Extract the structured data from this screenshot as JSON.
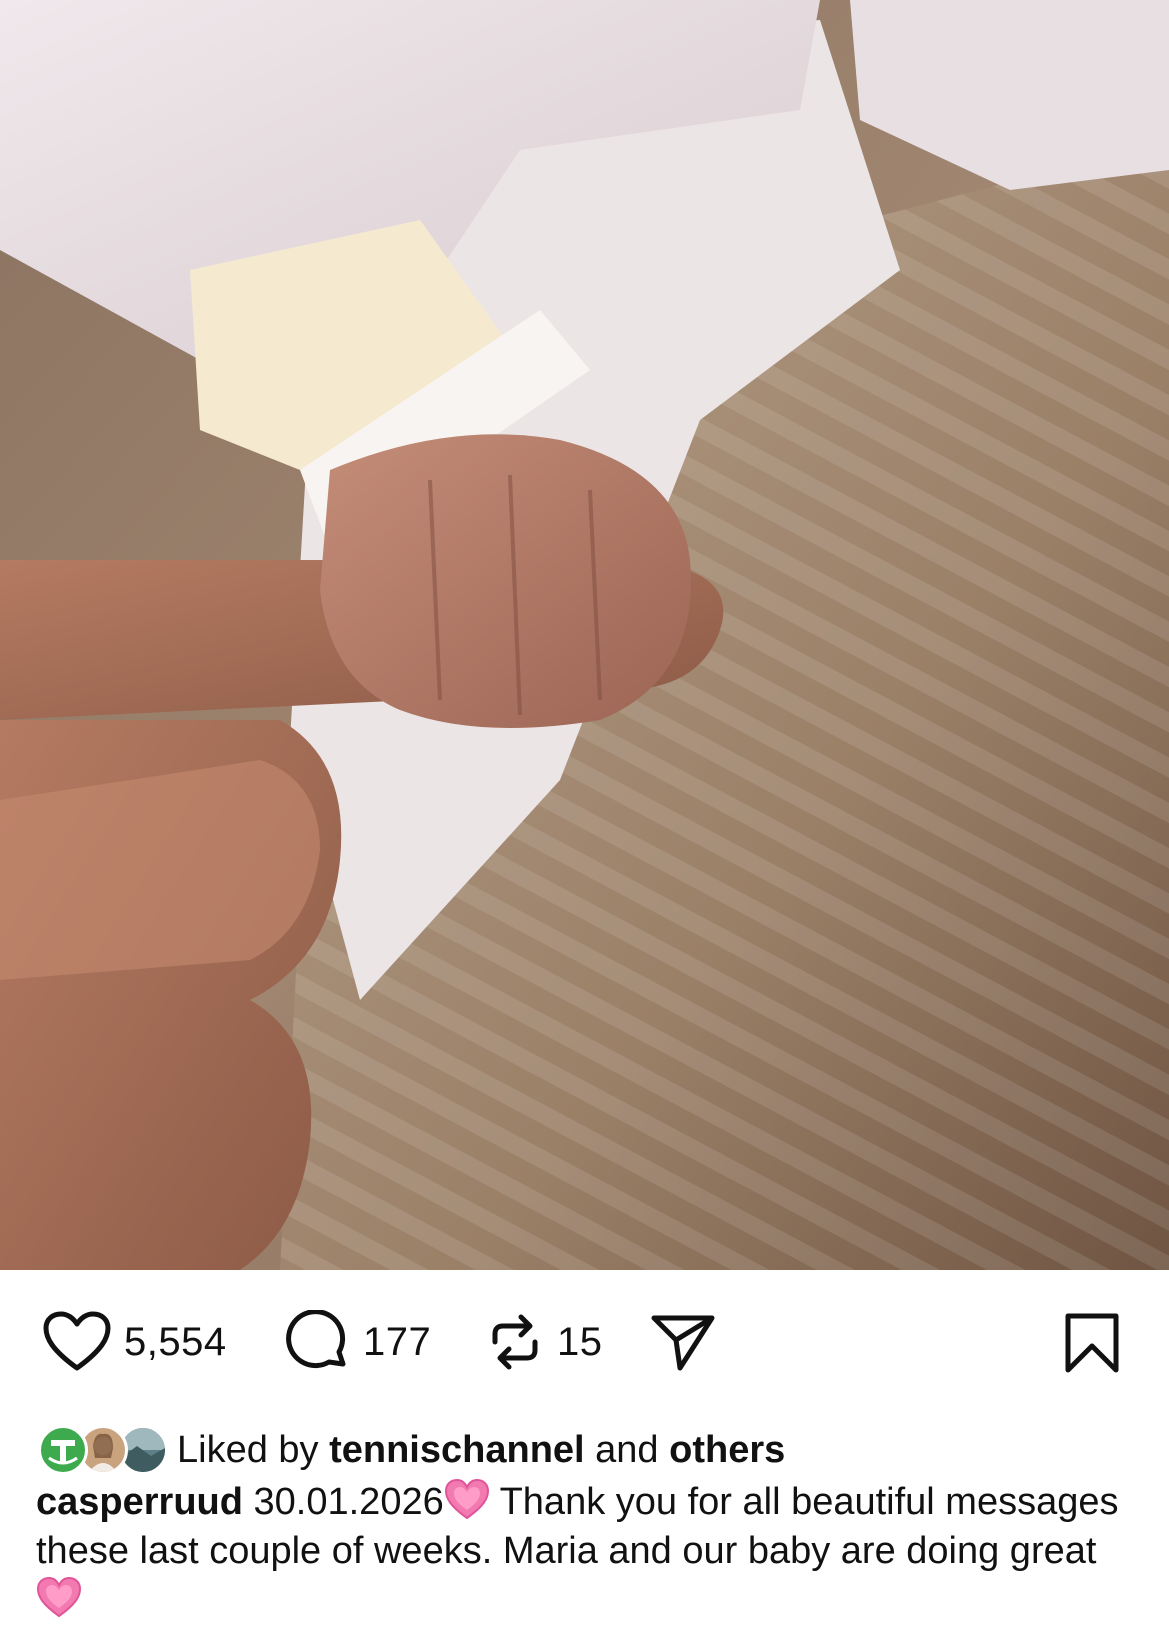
{
  "post": {
    "photo_alt": "baby-hand-photo",
    "actions": {
      "like_count": "5,554",
      "comment_count": "177",
      "repost_count": "15"
    },
    "liked_by": {
      "prefix": "Liked by ",
      "user": "tennischannel",
      "middle": " and ",
      "suffix": "others"
    },
    "caption": {
      "username": "casperruud",
      "date": "30.01.2026",
      "text_part1": " Thank you for all beautiful messages these last couple of weeks. Maria and our baby are doing great"
    },
    "icons": {
      "like": "heart-outline-icon",
      "comment": "comment-bubble-icon",
      "repost": "repost-arrows-icon",
      "share": "paper-plane-icon",
      "save": "bookmark-icon",
      "emoji": "pink-heart-emoji"
    },
    "colors": {
      "emoji_pink": "#f27ab0",
      "tennis_green": "#3daa4e"
    }
  }
}
